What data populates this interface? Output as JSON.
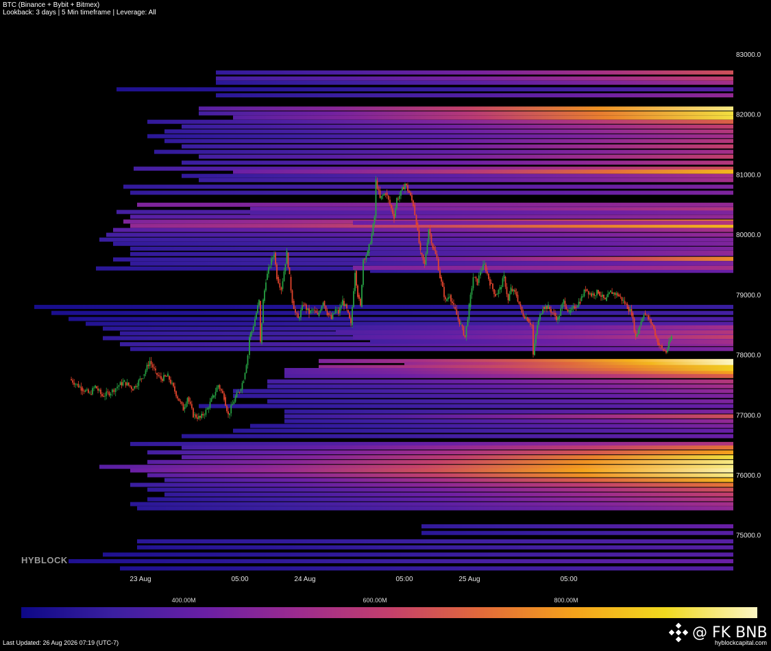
{
  "header": {
    "title": "BTC (Binance + Bybit + Bitmex)",
    "subtitle": "Lookback: 3 days | 5 Min timeframe | Leverage: All"
  },
  "watermark": "HYBLOCK",
  "footer": {
    "updated": "Last Updated: 26 Aug 2026 07:19 (UTC-7)",
    "site": "hyblockcapital.com",
    "handle": "@ FK BNB",
    "logo_icon": "binance-diamond-icon"
  },
  "colorbar": {
    "labels": [
      {
        "text": "400.00M",
        "value": 400
      },
      {
        "text": "600.00M",
        "value": 600
      },
      {
        "text": "800.00M",
        "value": 800
      }
    ],
    "min": 230,
    "max": 1000,
    "stops": [
      "#0d0887",
      "#3b1fa0",
      "#6a1fa5",
      "#9c2b8f",
      "#c33f6c",
      "#e26a3a",
      "#f5a21b",
      "#f0d91f",
      "#fcf6c4"
    ]
  },
  "chart_data": {
    "type": "heatmap",
    "x_range": [
      -41,
      173
    ],
    "y_range": [
      74330,
      83450
    ],
    "y_ticks": [
      {
        "value": 75000,
        "label": "75000.0"
      },
      {
        "value": 76000,
        "label": "76000.0"
      },
      {
        "value": 77000,
        "label": "77000.0"
      },
      {
        "value": 78000,
        "label": "78000.0"
      },
      {
        "value": 79000,
        "label": "79000.0"
      },
      {
        "value": 80000,
        "label": "80000.0"
      },
      {
        "value": 81000,
        "label": "81000.0"
      },
      {
        "value": 82000,
        "label": "82000.0"
      },
      {
        "value": 83000,
        "label": "83000.0"
      }
    ],
    "x_ticks": [
      {
        "value": 0,
        "label": "23 Aug"
      },
      {
        "value": 29,
        "label": "05:00"
      },
      {
        "value": 48,
        "label": "24 Aug"
      },
      {
        "value": 77,
        "label": "05:00"
      },
      {
        "value": 96,
        "label": "25 Aug"
      },
      {
        "value": 125,
        "label": "05:00"
      }
    ],
    "candle_colors": {
      "up": "#26a043",
      "down": "#e2442c"
    },
    "price_path": [
      [
        -20.6,
        77600
      ],
      [
        -17.3,
        77450
      ],
      [
        -14.8,
        77350
      ],
      [
        -13.2,
        77480
      ],
      [
        -11.2,
        77320
      ],
      [
        -8.7,
        77380
      ],
      [
        -6.3,
        77500
      ],
      [
        -4.7,
        77550
      ],
      [
        -2.2,
        77440
      ],
      [
        0.7,
        77650
      ],
      [
        2.7,
        77900
      ],
      [
        4.4,
        77700
      ],
      [
        6.0,
        77600
      ],
      [
        8.0,
        77650
      ],
      [
        10.0,
        77400
      ],
      [
        12.5,
        77100
      ],
      [
        13.7,
        77300
      ],
      [
        15.4,
        77000
      ],
      [
        17.4,
        76950
      ],
      [
        19.5,
        77100
      ],
      [
        21.1,
        77300
      ],
      [
        22.7,
        77500
      ],
      [
        24.4,
        77300
      ],
      [
        25.6,
        77000
      ],
      [
        27.7,
        77300
      ],
      [
        28.9,
        77400
      ],
      [
        30.1,
        77600
      ],
      [
        31.3,
        78000
      ],
      [
        31.8,
        78300
      ],
      [
        32.5,
        78400
      ],
      [
        33.4,
        78600
      ],
      [
        34.6,
        78900
      ],
      [
        35.0,
        78200
      ],
      [
        35.8,
        78900
      ],
      [
        36.6,
        79250
      ],
      [
        37.8,
        79500
      ],
      [
        39.0,
        79700
      ],
      [
        39.8,
        79300
      ],
      [
        41.1,
        79100
      ],
      [
        42.7,
        79700
      ],
      [
        43.5,
        79300
      ],
      [
        44.3,
        78900
      ],
      [
        45.2,
        78700
      ],
      [
        46.0,
        78600
      ],
      [
        47.6,
        78850
      ],
      [
        49.2,
        78700
      ],
      [
        50.4,
        78750
      ],
      [
        51.7,
        78650
      ],
      [
        53.3,
        78900
      ],
      [
        54.5,
        78700
      ],
      [
        55.7,
        78600
      ],
      [
        56.9,
        78750
      ],
      [
        57.8,
        78700
      ],
      [
        59.0,
        78900
      ],
      [
        60.2,
        78750
      ],
      [
        61.4,
        78500
      ],
      [
        62.6,
        79400
      ],
      [
        63.4,
        79000
      ],
      [
        64.2,
        78800
      ],
      [
        65.0,
        79600
      ],
      [
        66.3,
        79700
      ],
      [
        67.5,
        80000
      ],
      [
        68.3,
        80300
      ],
      [
        68.7,
        80900
      ],
      [
        69.9,
        80600
      ],
      [
        71.5,
        80700
      ],
      [
        72.8,
        80500
      ],
      [
        74.0,
        80300
      ],
      [
        74.8,
        80600
      ],
      [
        75.6,
        80650
      ],
      [
        77.2,
        80850
      ],
      [
        78.4,
        80700
      ],
      [
        79.6,
        80500
      ],
      [
        80.5,
        80200
      ],
      [
        81.7,
        79700
      ],
      [
        82.9,
        79500
      ],
      [
        84.1,
        80100
      ],
      [
        85.3,
        79800
      ],
      [
        86.5,
        79600
      ],
      [
        87.4,
        79300
      ],
      [
        89.0,
        78900
      ],
      [
        90.2,
        79000
      ],
      [
        91.4,
        78800
      ],
      [
        92.7,
        78600
      ],
      [
        93.5,
        78500
      ],
      [
        94.7,
        78300
      ],
      [
        95.9,
        78800
      ],
      [
        97.1,
        79300
      ],
      [
        98.3,
        79200
      ],
      [
        99.2,
        79400
      ],
      [
        100.4,
        79500
      ],
      [
        102.0,
        79200
      ],
      [
        103.6,
        79000
      ],
      [
        104.9,
        79100
      ],
      [
        106.1,
        79300
      ],
      [
        107.3,
        78900
      ],
      [
        108.1,
        79100
      ],
      [
        109.7,
        79000
      ],
      [
        111.3,
        78700
      ],
      [
        112.9,
        78600
      ],
      [
        114.2,
        78500
      ],
      [
        114.6,
        78000
      ],
      [
        115.8,
        78500
      ],
      [
        117.4,
        78800
      ],
      [
        119.0,
        78800
      ],
      [
        120.2,
        78700
      ],
      [
        121.8,
        78600
      ],
      [
        123.5,
        78900
      ],
      [
        125.1,
        78700
      ],
      [
        126.7,
        78800
      ],
      [
        128.3,
        78900
      ],
      [
        129.9,
        79100
      ],
      [
        131.6,
        79000
      ],
      [
        133.6,
        79050
      ],
      [
        135.6,
        78900
      ],
      [
        137.2,
        79050
      ],
      [
        139.3,
        79000
      ],
      [
        140.9,
        78900
      ],
      [
        142.1,
        78800
      ],
      [
        143.3,
        78700
      ],
      [
        144.5,
        78300
      ],
      [
        145.7,
        78500
      ],
      [
        146.9,
        78700
      ],
      [
        148.2,
        78600
      ],
      [
        149.4,
        78500
      ],
      [
        151.0,
        78200
      ],
      [
        152.2,
        78100
      ],
      [
        153.4,
        78050
      ],
      [
        155.0,
        78300
      ]
    ],
    "liquidation_levels": [
      [
        82700,
        22,
        0.1,
        0.55
      ],
      [
        82600,
        22,
        0.15,
        0.5
      ],
      [
        82530,
        22,
        0.08,
        0.4
      ],
      [
        82420,
        -7,
        0.05,
        0.2
      ],
      [
        82320,
        22,
        0.08,
        0.35
      ],
      [
        82100,
        17,
        0.2,
        0.95
      ],
      [
        82020,
        17,
        0.15,
        0.9
      ],
      [
        81950,
        27,
        0.2,
        0.9
      ],
      [
        81880,
        2,
        0.1,
        0.6
      ],
      [
        81800,
        12,
        0.12,
        0.5
      ],
      [
        81720,
        7,
        0.1,
        0.45
      ],
      [
        81640,
        2,
        0.08,
        0.4
      ],
      [
        81560,
        7,
        0.1,
        0.45
      ],
      [
        81470,
        12,
        0.12,
        0.5
      ],
      [
        81380,
        4,
        0.1,
        0.4
      ],
      [
        81300,
        17,
        0.15,
        0.5
      ],
      [
        81200,
        12,
        0.12,
        0.45
      ],
      [
        81100,
        -2,
        0.15,
        0.55
      ],
      [
        81050,
        27,
        0.25,
        0.8
      ],
      [
        80980,
        12,
        0.1,
        0.4
      ],
      [
        80910,
        17,
        0.12,
        0.4
      ],
      [
        80800,
        -5,
        0.1,
        0.3
      ],
      [
        80700,
        -3,
        0.1,
        0.3
      ],
      [
        80500,
        -1,
        0.3,
        0.35
      ],
      [
        80430,
        32,
        0.2,
        0.35
      ],
      [
        80380,
        -7,
        0.15,
        0.35
      ],
      [
        80300,
        -3,
        0.2,
        0.35
      ],
      [
        80220,
        -5,
        0.3,
        0.7
      ],
      [
        80150,
        -3,
        0.35,
        0.8
      ],
      [
        80080,
        -8,
        0.2,
        0.4
      ],
      [
        80000,
        -10,
        0.15,
        0.35
      ],
      [
        79920,
        -12,
        0.12,
        0.3
      ],
      [
        79850,
        -8,
        0.1,
        0.3
      ],
      [
        79770,
        -3,
        0.1,
        0.3
      ],
      [
        79680,
        -3,
        0.1,
        0.3
      ],
      [
        79590,
        -8,
        0.1,
        0.25
      ],
      [
        79520,
        -3,
        0.1,
        0.25
      ],
      [
        79440,
        -13,
        0.08,
        0.2
      ],
      [
        79700,
        67,
        0.15,
        0.35
      ],
      [
        79600,
        67,
        0.2,
        0.7
      ],
      [
        79520,
        67,
        0.15,
        0.3
      ],
      [
        79400,
        67,
        0.1,
        0.25
      ],
      [
        80200,
        62,
        0.25,
        0.45
      ],
      [
        80420,
        32,
        0.25,
        0.45
      ],
      [
        80370,
        32,
        0.18,
        0.3
      ],
      [
        79450,
        62,
        0.3,
        0.4
      ],
      [
        78800,
        -31,
        0.03,
        0.12
      ],
      [
        78700,
        -26,
        0.04,
        0.15
      ],
      [
        78600,
        -21,
        0.05,
        0.18
      ],
      [
        78520,
        -16,
        0.06,
        0.2
      ],
      [
        78440,
        -11,
        0.08,
        0.25
      ],
      [
        78360,
        -6,
        0.1,
        0.28
      ],
      [
        78280,
        -11,
        0.1,
        0.3
      ],
      [
        78180,
        -6,
        0.12,
        0.35
      ],
      [
        78100,
        -3,
        0.1,
        0.3
      ],
      [
        78460,
        62,
        0.15,
        0.4
      ],
      [
        78380,
        57,
        0.18,
        0.45
      ],
      [
        78300,
        62,
        0.2,
        0.5
      ],
      [
        78220,
        67,
        0.15,
        0.4
      ],
      [
        77900,
        52,
        0.3,
        1.0
      ],
      [
        77850,
        77,
        0.35,
        1.0
      ],
      [
        77800,
        52,
        0.35,
        0.85
      ],
      [
        77750,
        42,
        0.2,
        0.85
      ],
      [
        77700,
        42,
        0.2,
        0.75
      ],
      [
        77650,
        42,
        0.18,
        0.6
      ],
      [
        77560,
        37,
        0.15,
        0.45
      ],
      [
        77480,
        37,
        0.12,
        0.4
      ],
      [
        77400,
        27,
        0.1,
        0.35
      ],
      [
        77320,
        27,
        0.1,
        0.3
      ],
      [
        77230,
        37,
        0.1,
        0.3
      ],
      [
        77150,
        17,
        0.08,
        0.25
      ],
      [
        77060,
        42,
        0.1,
        0.3
      ],
      [
        76980,
        42,
        0.12,
        0.55
      ],
      [
        76900,
        42,
        0.1,
        0.35
      ],
      [
        76820,
        32,
        0.08,
        0.3
      ],
      [
        76740,
        27,
        0.08,
        0.25
      ],
      [
        76650,
        12,
        0.08,
        0.25
      ],
      [
        76520,
        -3,
        0.1,
        0.45
      ],
      [
        76460,
        12,
        0.15,
        0.65
      ],
      [
        76380,
        2,
        0.15,
        0.75
      ],
      [
        76300,
        12,
        0.2,
        0.9
      ],
      [
        76220,
        2,
        0.2,
        0.95
      ],
      [
        76140,
        -12,
        0.2,
        0.95
      ],
      [
        76080,
        -3,
        0.25,
        0.98
      ],
      [
        76000,
        2,
        0.2,
        0.95
      ],
      [
        75920,
        7,
        0.15,
        0.8
      ],
      [
        75840,
        -3,
        0.12,
        0.65
      ],
      [
        75760,
        2,
        0.1,
        0.55
      ],
      [
        75680,
        7,
        0.1,
        0.5
      ],
      [
        75600,
        2,
        0.08,
        0.45
      ],
      [
        75520,
        -3,
        0.08,
        0.4
      ],
      [
        75450,
        -1,
        0.08,
        0.35
      ],
      [
        75150,
        82,
        0.1,
        0.25
      ],
      [
        75040,
        82,
        0.08,
        0.2
      ],
      [
        74900,
        -1,
        0.08,
        0.2
      ],
      [
        74800,
        -1,
        0.06,
        0.2
      ],
      [
        74680,
        -11,
        0.05,
        0.2
      ],
      [
        74570,
        -21,
        0.05,
        0.25
      ],
      [
        74450,
        -6,
        0.05,
        0.2
      ]
    ]
  }
}
